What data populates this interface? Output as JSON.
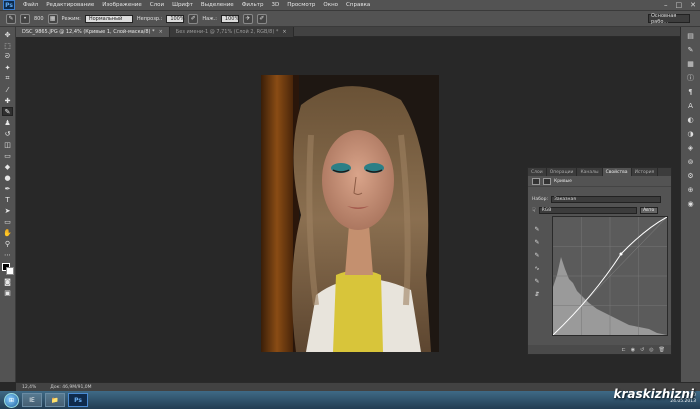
{
  "app": {
    "logo": "Ps"
  },
  "menubar": {
    "items": [
      "Файл",
      "Редактирование",
      "Изображение",
      "Слои",
      "Шрифт",
      "Выделение",
      "Фильтр",
      "3D",
      "Просмотр",
      "Окно",
      "Справка"
    ],
    "win_controls": [
      "–",
      "□",
      "✕"
    ]
  },
  "options_bar": {
    "brush_size": "800",
    "mode_label": "Режим:",
    "mode_value": "Нормальный",
    "opacity_label": "Непрозр.:",
    "opacity_value": "100%",
    "flow_label": "Наж.:",
    "flow_value": "100%",
    "workspace": "Основная рабо..."
  },
  "tabs": [
    {
      "label": "DSC_9865.JPG @ 12,4% (Кривые 1, Слой-маска/8) *",
      "active": true
    },
    {
      "label": "Без имени-1 @ 7,71% (Слой 2, RGB/8) *",
      "active": false
    }
  ],
  "properties": {
    "tabs": [
      "Слои",
      "Операции",
      "Каналы",
      "Свойства",
      "История"
    ],
    "active_tab": "Свойства",
    "title": "Кривые",
    "preset_label": "Набор:",
    "preset_value": "Заказная",
    "channel_value": "RGB",
    "auto_label": "Авто",
    "tools": [
      "☟",
      "✎",
      "✎",
      "✎",
      "∿",
      "✎",
      "⇵"
    ]
  },
  "statusbar": {
    "zoom": "12,4%",
    "doc": "Док: 46,9M/91,0M"
  },
  "taskbar": {
    "apps": [
      "IE",
      "📁",
      "Ps"
    ],
    "time": "21:40",
    "date": "24.05.2013"
  },
  "watermark": "kraskizhizni",
  "colors": {
    "accent": "#3b7ed0",
    "panel": "#535353",
    "canvas": "#282828"
  }
}
